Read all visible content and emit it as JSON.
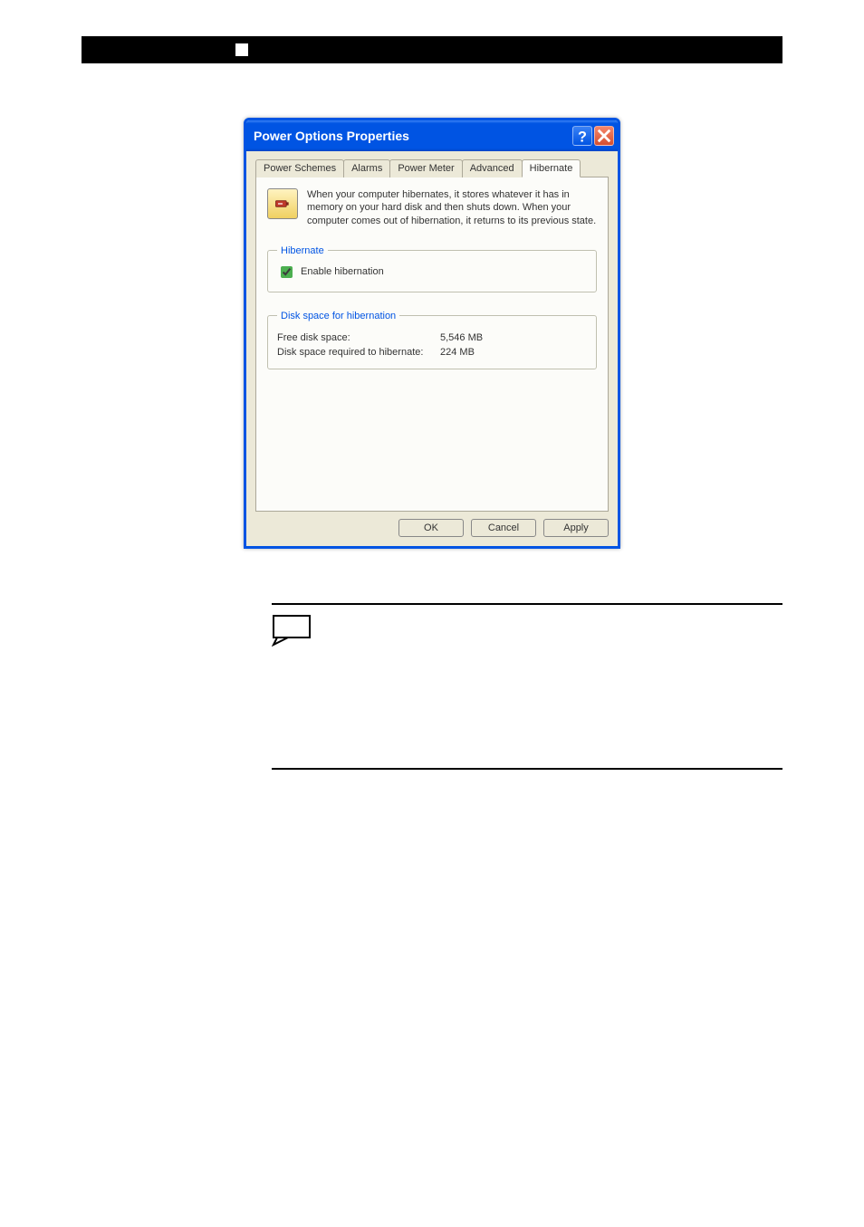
{
  "dialog": {
    "title": "Power Options Properties",
    "tabs": [
      "Power Schemes",
      "Alarms",
      "Power Meter",
      "Advanced",
      "Hibernate"
    ],
    "active_tab": "Hibernate",
    "intro_text": "When your computer hibernates, it stores whatever it has in memory on your hard disk and then shuts down. When your computer comes out of hibernation, it returns to its previous state.",
    "hibernate_group": {
      "legend": "Hibernate",
      "checkbox_label": "Enable hibernation",
      "checked": true
    },
    "diskspace_group": {
      "legend": "Disk space for hibernation",
      "free_label": "Free disk space:",
      "free_value": "5,546 MB",
      "required_label": "Disk space required to hibernate:",
      "required_value": "224 MB"
    },
    "buttons": {
      "ok": "OK",
      "cancel": "Cancel",
      "apply": "Apply"
    }
  }
}
